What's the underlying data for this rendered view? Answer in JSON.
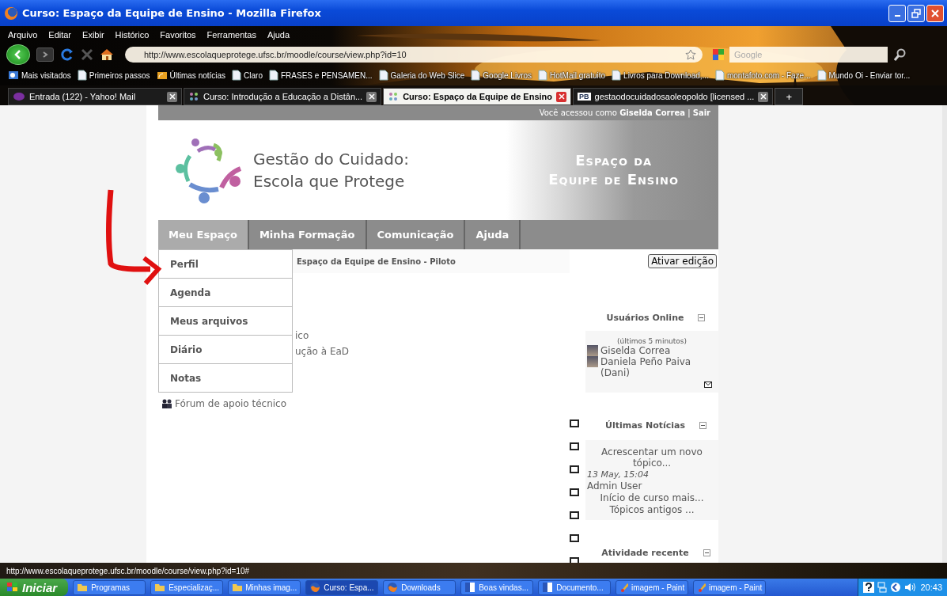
{
  "window": {
    "title": "Curso: Espaço da Equipe de Ensino - Mozilla Firefox"
  },
  "menu": [
    "Arquivo",
    "Editar",
    "Exibir",
    "Histórico",
    "Favoritos",
    "Ferramentas",
    "Ajuda"
  ],
  "toolbar": {
    "url": "http://www.escolaqueprotege.ufsc.br/moodle/course/view.php?id=10",
    "search_placeholder": "Google"
  },
  "bookmarks": [
    {
      "label": "Mais visitados",
      "kind": "smart"
    },
    {
      "label": "Primeiros passos",
      "kind": "page"
    },
    {
      "label": "Últimas notícias",
      "kind": "feed"
    },
    {
      "label": "Claro",
      "kind": "page"
    },
    {
      "label": "FRASES e PENSAMEN...",
      "kind": "page"
    },
    {
      "label": "Galeria do Web Slice",
      "kind": "page"
    },
    {
      "label": "Google Livros",
      "kind": "page"
    },
    {
      "label": "HotMail gratuito",
      "kind": "page"
    },
    {
      "label": "Livros para Download,...",
      "kind": "page"
    },
    {
      "label": "montafoto.com - Faze...",
      "kind": "page"
    },
    {
      "label": "Mundo Oi - Enviar tor...",
      "kind": "page"
    }
  ],
  "tabs": [
    {
      "label": "Entrada (122) - Yahoo! Mail",
      "selected": false,
      "kind": "mail"
    },
    {
      "label": "Curso: Introdução a Educação a Distân...",
      "selected": false,
      "kind": "course"
    },
    {
      "label": "Curso: Espaço da Equipe de Ensino",
      "selected": true,
      "kind": "course"
    },
    {
      "label": "gestaodocuidadosaoleopoldo [licensed ...",
      "selected": false,
      "kind": "pb",
      "badge": "PB"
    }
  ],
  "new_tab": "+",
  "page": {
    "user_bar": {
      "prefix": "Você acessou como",
      "user": "Giselda Correa",
      "separator": "|",
      "logout": "Sair"
    },
    "site_title": [
      "Gestão do Cuidado:",
      "Escola que Protege"
    ],
    "banner": [
      "Espaço da",
      "Equipe de Ensino"
    ],
    "nav": [
      {
        "label": "Meu Espaço",
        "selected": true
      },
      {
        "label": "Minha Formação",
        "selected": false
      },
      {
        "label": "Comunicação",
        "selected": false
      },
      {
        "label": "Ajuda",
        "selected": false
      }
    ],
    "dropdown": [
      "Perfil",
      "Agenda",
      "Meus arquivos",
      "Diário",
      "Notas"
    ],
    "breadcrumb": "Espaço da Equipe de Ensino - Piloto",
    "edit_button": "Ativar edição",
    "partial_lines": [
      "ico",
      "ução à EaD"
    ],
    "forum_link": "Fórum de apoio técnico",
    "blocks": [
      {
        "kind": "online",
        "title": "Usuários Online",
        "subtitle": "(últimos 5 minutos)",
        "users": [
          "Giselda Correa",
          "Daniela Peño Paiva (Dani)"
        ]
      },
      {
        "kind": "news",
        "title": "Últimas Notícias",
        "add_link": "Acrescentar um novo tópico...",
        "date": "13 May, 15:04",
        "author": "Admin User",
        "post": "Início de curso mais...",
        "older": "Tópicos antigos ..."
      },
      {
        "kind": "heading",
        "title": "Atividade recente"
      }
    ]
  },
  "status_bar": "http://www.escolaqueprotege.ufsc.br/moodle/course/view.php?id=10#",
  "taskbar": {
    "start": "Iniciar",
    "items": [
      {
        "label": "Programas",
        "kind": "folder",
        "selected": false
      },
      {
        "label": "Especializaç...",
        "kind": "folder",
        "selected": false
      },
      {
        "label": "Minhas imag...",
        "kind": "folder",
        "selected": false
      },
      {
        "label": "Curso: Espa...",
        "kind": "firefox",
        "selected": true
      },
      {
        "label": "Downloads",
        "kind": "firefox",
        "selected": false
      },
      {
        "label": "Boas vindas...",
        "kind": "word",
        "selected": false
      },
      {
        "label": "Documento...",
        "kind": "word",
        "selected": false
      },
      {
        "label": "imagem - Paint",
        "kind": "paint",
        "selected": false
      },
      {
        "label": "imagem - Paint",
        "kind": "paint",
        "selected": false
      }
    ],
    "clock": "20:43"
  }
}
